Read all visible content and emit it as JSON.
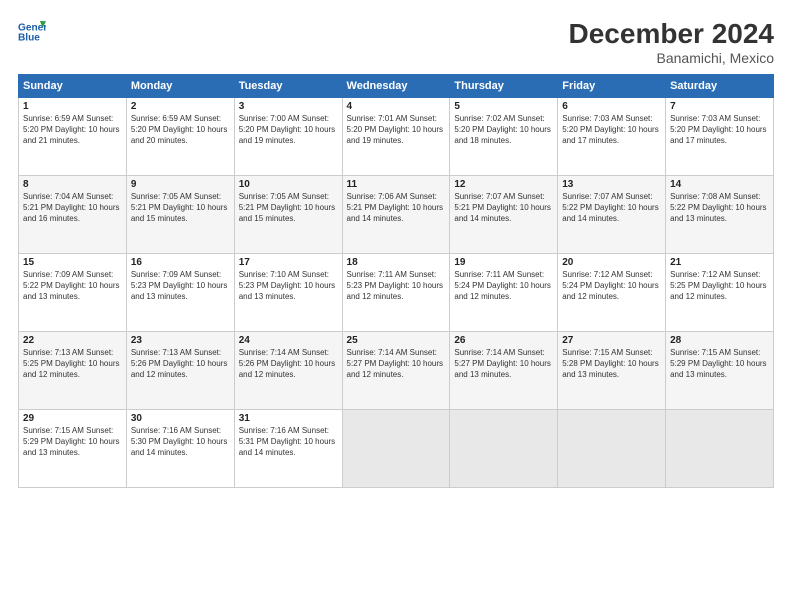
{
  "header": {
    "logo_line1": "General",
    "logo_line2": "Blue",
    "month": "December 2024",
    "location": "Banamichi, Mexico"
  },
  "weekdays": [
    "Sunday",
    "Monday",
    "Tuesday",
    "Wednesday",
    "Thursday",
    "Friday",
    "Saturday"
  ],
  "weeks": [
    [
      {
        "day": 1,
        "info": "Sunrise: 6:59 AM\nSunset: 5:20 PM\nDaylight: 10 hours\nand 21 minutes."
      },
      {
        "day": 2,
        "info": "Sunrise: 6:59 AM\nSunset: 5:20 PM\nDaylight: 10 hours\nand 20 minutes."
      },
      {
        "day": 3,
        "info": "Sunrise: 7:00 AM\nSunset: 5:20 PM\nDaylight: 10 hours\nand 19 minutes."
      },
      {
        "day": 4,
        "info": "Sunrise: 7:01 AM\nSunset: 5:20 PM\nDaylight: 10 hours\nand 19 minutes."
      },
      {
        "day": 5,
        "info": "Sunrise: 7:02 AM\nSunset: 5:20 PM\nDaylight: 10 hours\nand 18 minutes."
      },
      {
        "day": 6,
        "info": "Sunrise: 7:03 AM\nSunset: 5:20 PM\nDaylight: 10 hours\nand 17 minutes."
      },
      {
        "day": 7,
        "info": "Sunrise: 7:03 AM\nSunset: 5:20 PM\nDaylight: 10 hours\nand 17 minutes."
      }
    ],
    [
      {
        "day": 8,
        "info": "Sunrise: 7:04 AM\nSunset: 5:21 PM\nDaylight: 10 hours\nand 16 minutes."
      },
      {
        "day": 9,
        "info": "Sunrise: 7:05 AM\nSunset: 5:21 PM\nDaylight: 10 hours\nand 15 minutes."
      },
      {
        "day": 10,
        "info": "Sunrise: 7:05 AM\nSunset: 5:21 PM\nDaylight: 10 hours\nand 15 minutes."
      },
      {
        "day": 11,
        "info": "Sunrise: 7:06 AM\nSunset: 5:21 PM\nDaylight: 10 hours\nand 14 minutes."
      },
      {
        "day": 12,
        "info": "Sunrise: 7:07 AM\nSunset: 5:21 PM\nDaylight: 10 hours\nand 14 minutes."
      },
      {
        "day": 13,
        "info": "Sunrise: 7:07 AM\nSunset: 5:22 PM\nDaylight: 10 hours\nand 14 minutes."
      },
      {
        "day": 14,
        "info": "Sunrise: 7:08 AM\nSunset: 5:22 PM\nDaylight: 10 hours\nand 13 minutes."
      }
    ],
    [
      {
        "day": 15,
        "info": "Sunrise: 7:09 AM\nSunset: 5:22 PM\nDaylight: 10 hours\nand 13 minutes."
      },
      {
        "day": 16,
        "info": "Sunrise: 7:09 AM\nSunset: 5:23 PM\nDaylight: 10 hours\nand 13 minutes."
      },
      {
        "day": 17,
        "info": "Sunrise: 7:10 AM\nSunset: 5:23 PM\nDaylight: 10 hours\nand 13 minutes."
      },
      {
        "day": 18,
        "info": "Sunrise: 7:11 AM\nSunset: 5:23 PM\nDaylight: 10 hours\nand 12 minutes."
      },
      {
        "day": 19,
        "info": "Sunrise: 7:11 AM\nSunset: 5:24 PM\nDaylight: 10 hours\nand 12 minutes."
      },
      {
        "day": 20,
        "info": "Sunrise: 7:12 AM\nSunset: 5:24 PM\nDaylight: 10 hours\nand 12 minutes."
      },
      {
        "day": 21,
        "info": "Sunrise: 7:12 AM\nSunset: 5:25 PM\nDaylight: 10 hours\nand 12 minutes."
      }
    ],
    [
      {
        "day": 22,
        "info": "Sunrise: 7:13 AM\nSunset: 5:25 PM\nDaylight: 10 hours\nand 12 minutes."
      },
      {
        "day": 23,
        "info": "Sunrise: 7:13 AM\nSunset: 5:26 PM\nDaylight: 10 hours\nand 12 minutes."
      },
      {
        "day": 24,
        "info": "Sunrise: 7:14 AM\nSunset: 5:26 PM\nDaylight: 10 hours\nand 12 minutes."
      },
      {
        "day": 25,
        "info": "Sunrise: 7:14 AM\nSunset: 5:27 PM\nDaylight: 10 hours\nand 12 minutes."
      },
      {
        "day": 26,
        "info": "Sunrise: 7:14 AM\nSunset: 5:27 PM\nDaylight: 10 hours\nand 13 minutes."
      },
      {
        "day": 27,
        "info": "Sunrise: 7:15 AM\nSunset: 5:28 PM\nDaylight: 10 hours\nand 13 minutes."
      },
      {
        "day": 28,
        "info": "Sunrise: 7:15 AM\nSunset: 5:29 PM\nDaylight: 10 hours\nand 13 minutes."
      }
    ],
    [
      {
        "day": 29,
        "info": "Sunrise: 7:15 AM\nSunset: 5:29 PM\nDaylight: 10 hours\nand 13 minutes."
      },
      {
        "day": 30,
        "info": "Sunrise: 7:16 AM\nSunset: 5:30 PM\nDaylight: 10 hours\nand 14 minutes."
      },
      {
        "day": 31,
        "info": "Sunrise: 7:16 AM\nSunset: 5:31 PM\nDaylight: 10 hours\nand 14 minutes."
      },
      null,
      null,
      null,
      null
    ]
  ]
}
